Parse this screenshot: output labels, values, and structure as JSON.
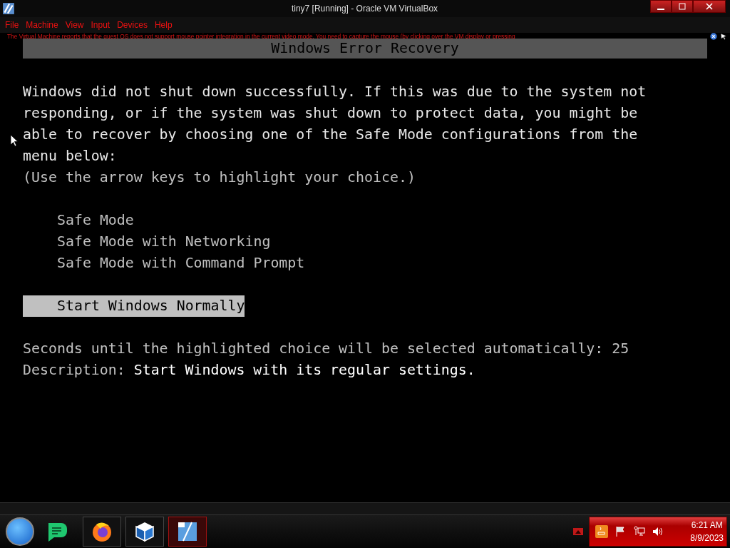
{
  "window": {
    "title": "tiny7 [Running] - Oracle VM VirtualBox"
  },
  "menu": [
    "File",
    "Machine",
    "View",
    "Input",
    "Devices",
    "Help"
  ],
  "notification": {
    "message": "The Virtual Machine reports that the guest OS does not support mouse pointer integration in the current video mode. You need to capture the mouse (by clicking over the VM display or pressing"
  },
  "console": {
    "title": "Windows Error Recovery",
    "paragraph": [
      "Windows did not shut down successfully. If this was due to the system not",
      "responding, or if the system was shut down to protect data, you might be",
      "able to recover by choosing one of the Safe Mode configurations from the",
      "menu below:"
    ],
    "hint": "(Use the arrow keys to highlight your choice.)",
    "options": [
      {
        "label": "Safe Mode",
        "selected": false
      },
      {
        "label": "Safe Mode with Networking",
        "selected": false
      },
      {
        "label": "Safe Mode with Command Prompt",
        "selected": false
      },
      {
        "label": "Start Windows Normally",
        "selected": true
      }
    ],
    "countdown": "Seconds until the highlighted choice will be selected automatically: 25",
    "description_label": "Description:",
    "description": "Start Windows with its regular settings."
  },
  "clock": {
    "time": "6:21 AM",
    "date": "8/9/2023"
  }
}
